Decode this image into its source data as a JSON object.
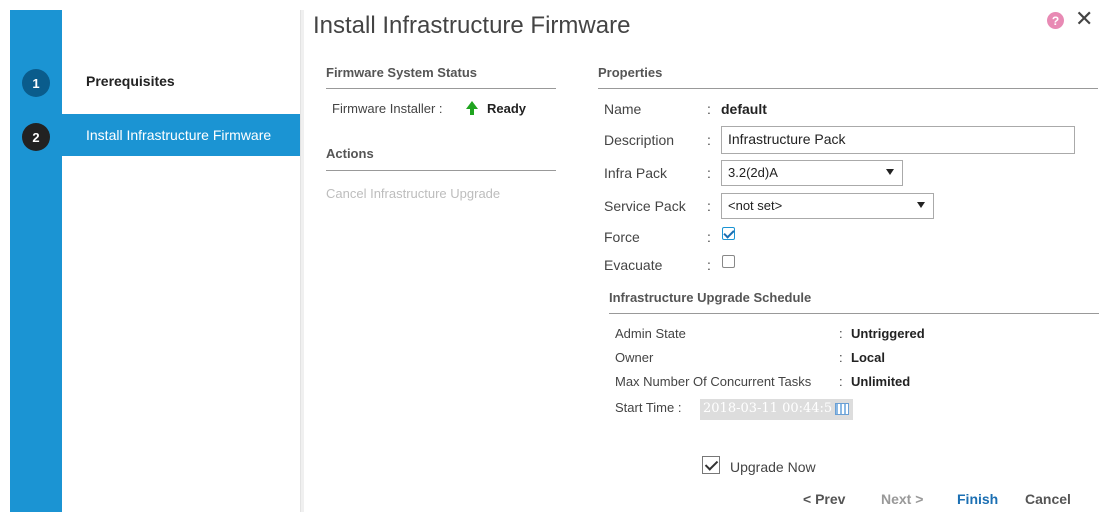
{
  "wizard": {
    "steps": [
      {
        "number": "1",
        "label": "Prerequisites"
      },
      {
        "number": "2",
        "label": "Install Infrastructure Firmware"
      }
    ]
  },
  "dialog": {
    "title": "Install Infrastructure Firmware",
    "help_icon": "question-icon",
    "close_icon": "close-icon",
    "close_glyph": "✕",
    "help_glyph": "?"
  },
  "firmware_status": {
    "heading": "Firmware System Status",
    "installer_label": "Firmware Installer :",
    "installer_value": "Ready"
  },
  "actions": {
    "heading": "Actions",
    "cancel_upgrade": "Cancel Infrastructure Upgrade"
  },
  "properties": {
    "heading": "Properties",
    "name_label": "Name",
    "name_value": "default",
    "description_label": "Description",
    "description_value": "Infrastructure Pack",
    "infra_pack_label": "Infra Pack",
    "infra_pack_value": "3.2(2d)A",
    "service_pack_label": "Service Pack",
    "service_pack_value": "<not set>",
    "force_label": "Force",
    "force_checked": true,
    "evacuate_label": "Evacuate",
    "evacuate_checked": false,
    "colon": ":"
  },
  "schedule": {
    "heading": "Infrastructure Upgrade Schedule",
    "admin_state_label": "Admin State",
    "admin_state_value": "Untriggered",
    "owner_label": "Owner",
    "owner_value": "Local",
    "max_tasks_label": "Max Number Of Concurrent Tasks",
    "max_tasks_value": "Unlimited",
    "start_time_label": "Start Time :",
    "start_time_value": "2018-03-11 00:44:5"
  },
  "upgrade_now": {
    "label": "Upgrade Now",
    "checked": true
  },
  "footer": {
    "prev": "< Prev",
    "next": "Next >",
    "finish": "Finish",
    "cancel": "Cancel"
  },
  "colors": {
    "accent": "#1b94d3",
    "finish_link": "#1b6fb3",
    "ready_arrow": "#1fa41f"
  }
}
